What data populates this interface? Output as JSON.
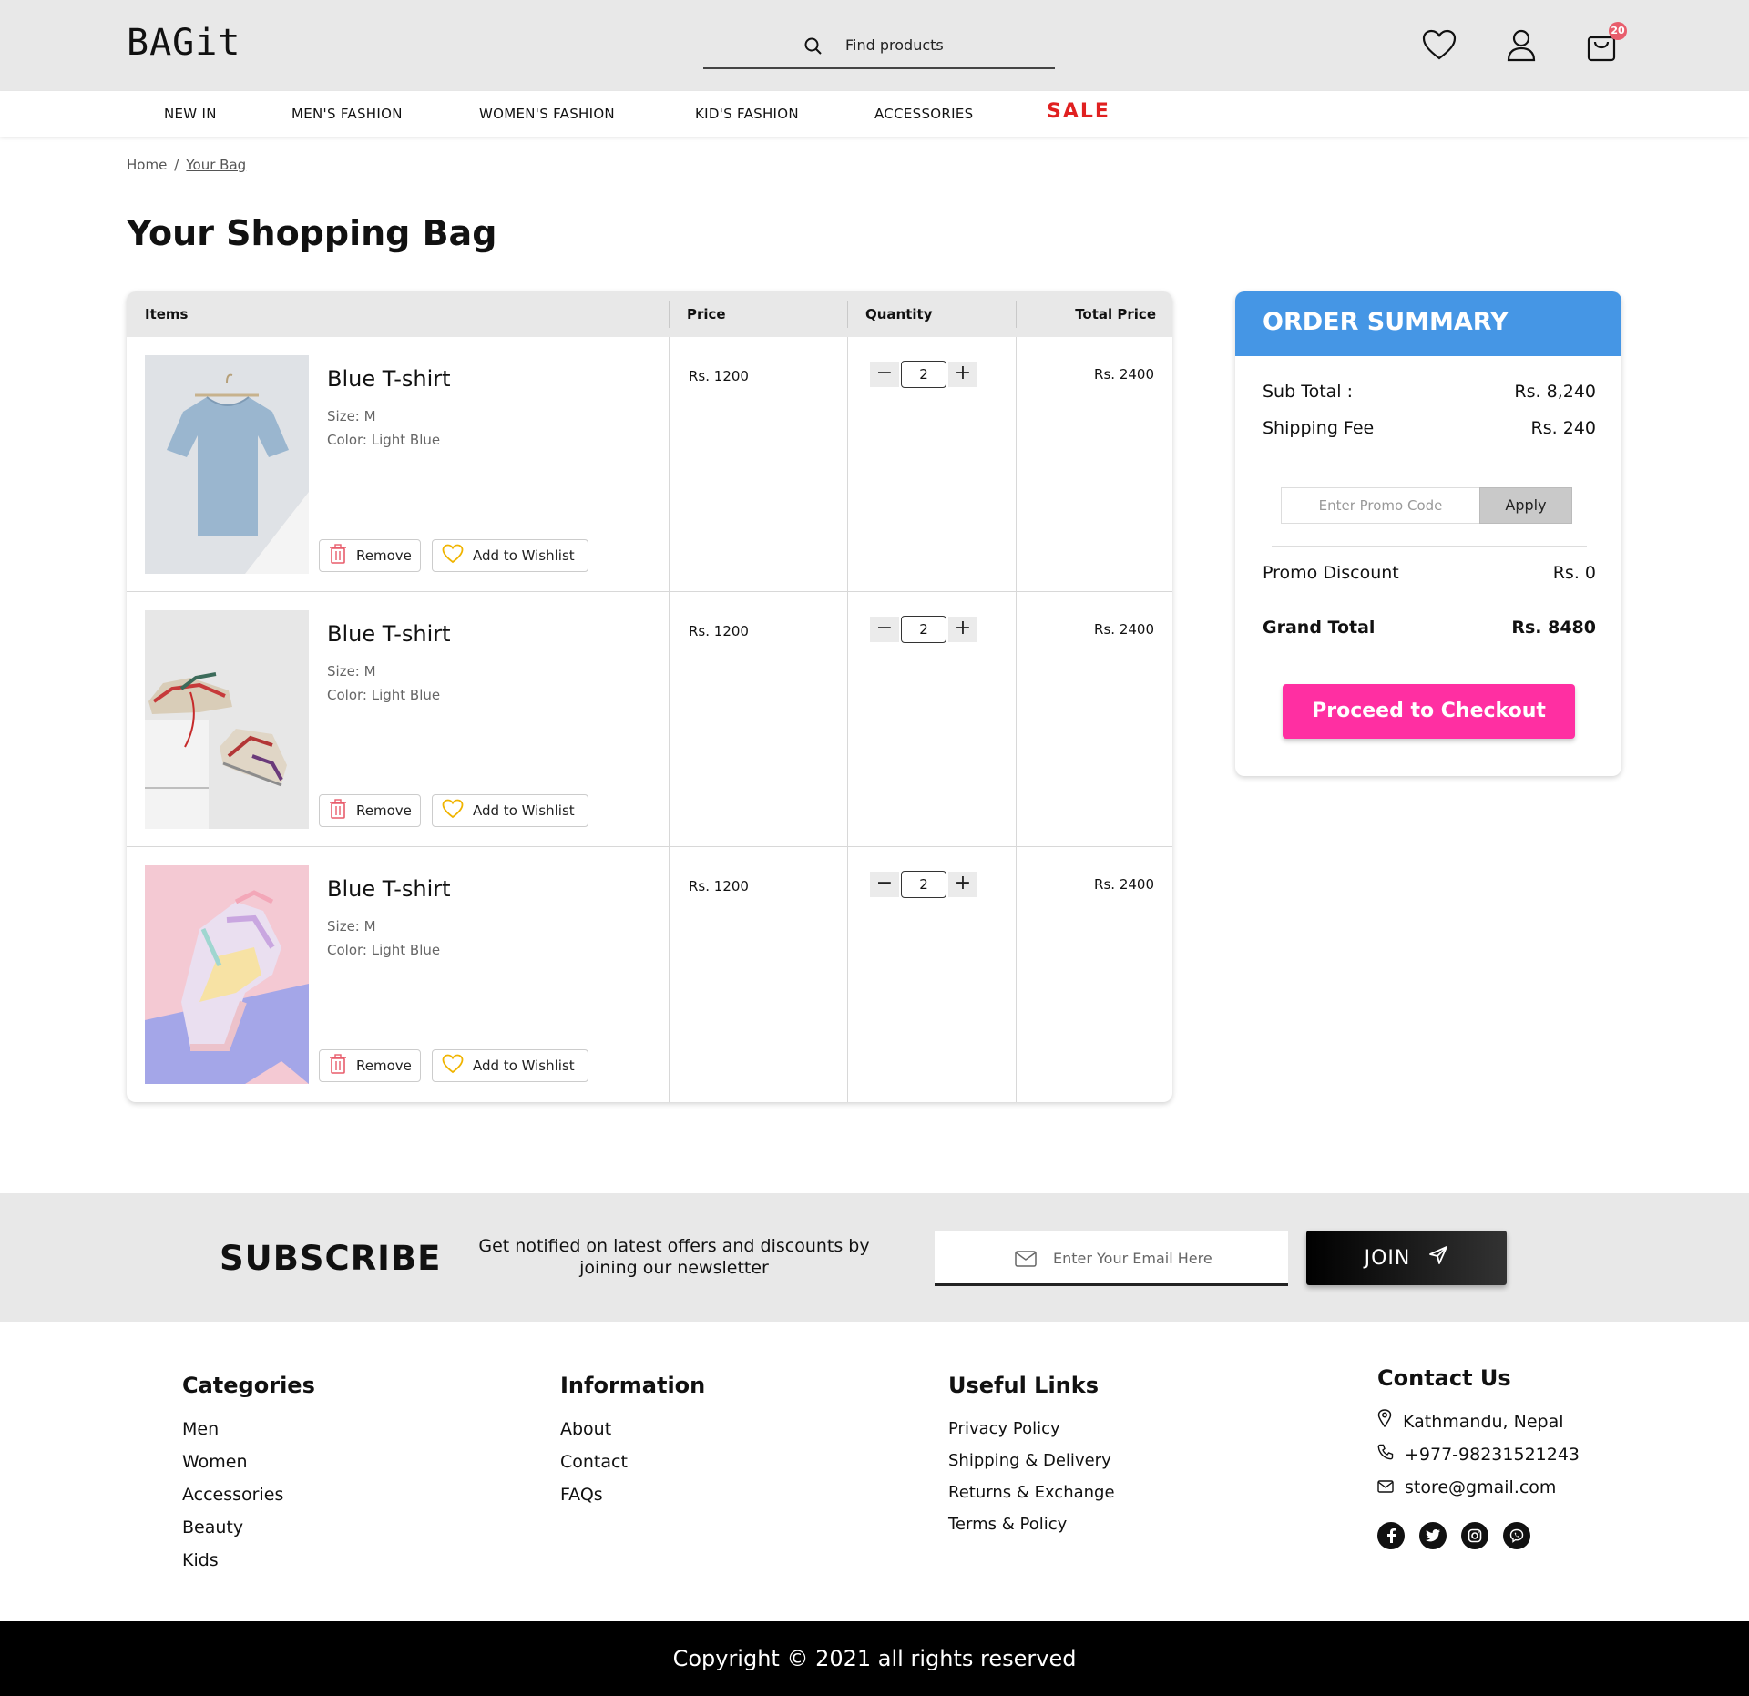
{
  "header": {
    "logo": "BAGit",
    "search_placeholder": "Find products",
    "cart_count": "20"
  },
  "nav": {
    "items": [
      "NEW IN",
      "MEN'S FASHION",
      "WOMEN'S FASHION",
      "KID'S FASHION",
      "ACCESSORIES"
    ],
    "sale": "SALE",
    "sale_color": "#e02020"
  },
  "breadcrumb": {
    "home": "Home",
    "separator": "/",
    "current": "Your Bag"
  },
  "page_title": "Your Shopping Bag",
  "cart": {
    "columns": {
      "items": "Items",
      "price": "Price",
      "quantity": "Quantity",
      "total": "Total Price"
    },
    "remove_label": "Remove",
    "wishlist_label": "Add to Wishlist",
    "rows": [
      {
        "name": "Blue T-shirt",
        "size": "Size: M",
        "color": "Color: Light Blue",
        "price": "Rs. 1200",
        "qty": "2",
        "total": "Rs. 2400",
        "image": "blue-tshirt-on-hanger"
      },
      {
        "name": "Blue T-shirt",
        "size": "Size: M",
        "color": "Color: Light Blue",
        "price": "Rs. 1200",
        "qty": "2",
        "total": "Rs. 2400",
        "image": "sneakers-on-white-box"
      },
      {
        "name": "Blue T-shirt",
        "size": "Size: M",
        "color": "Color: Light Blue",
        "price": "Rs. 1200",
        "qty": "2",
        "total": "Rs. 2400",
        "image": "pastel-sneaker"
      }
    ]
  },
  "summary": {
    "title": "ORDER SUMMARY",
    "subtotal_label": "Sub Total :",
    "subtotal": "Rs. 8,240",
    "shipping_label": "Shipping Fee",
    "shipping": "Rs. 240",
    "promo_placeholder": "Enter Promo Code",
    "apply_label": "Apply",
    "discount_label": "Promo Discount",
    "discount": "Rs. 0",
    "grand_label": "Grand Total",
    "grand": "Rs. 8480",
    "checkout_label": "Proceed to Checkout",
    "accent": "#4596e5",
    "checkout_color": "#ff2fa2"
  },
  "subscribe": {
    "title": "SUBSCRIBE",
    "text": "Get notified on latest offers and discounts by joining our newsletter",
    "placeholder": "Enter Your Email Here",
    "button": "JOIN"
  },
  "footer": {
    "categories": {
      "title": "Categories",
      "links": [
        "Men",
        "Women",
        "Accessories",
        "Beauty",
        "Kids"
      ]
    },
    "information": {
      "title": "Information",
      "links": [
        "About",
        "Contact",
        "FAQs"
      ]
    },
    "useful": {
      "title": "Useful Links",
      "links": [
        "Privacy Policy",
        "Shipping & Delivery",
        "Returns & Exchange",
        "Terms & Policy"
      ]
    },
    "contact": {
      "title": "Contact Us",
      "address": "Kathmandu, Nepal",
      "phone": "+977-98231521243",
      "email": "store@gmail.com",
      "socials": [
        "facebook-icon",
        "twitter-icon",
        "instagram-icon",
        "viber-icon"
      ]
    },
    "copyright": "Copyright © 2021 all rights reserved"
  }
}
